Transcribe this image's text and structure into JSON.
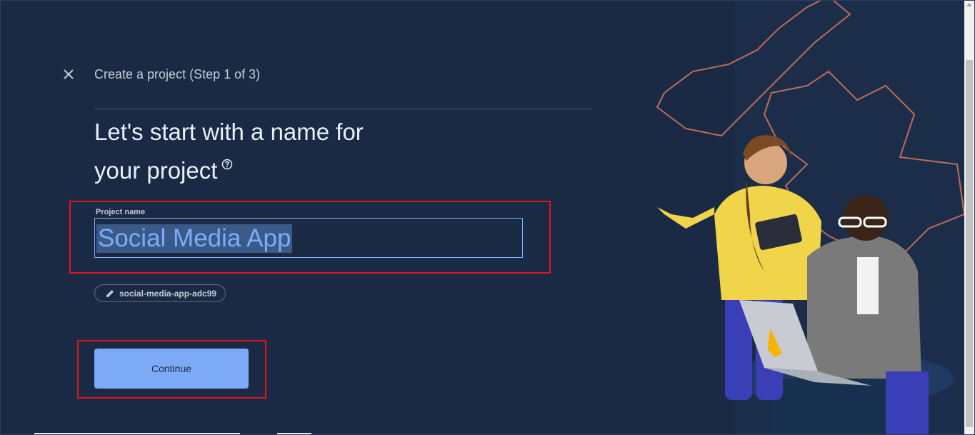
{
  "header": {
    "step_title": "Create a project (Step 1 of 3)"
  },
  "main": {
    "heading_line1": "Let's start with a name for",
    "heading_line2": "your project",
    "project_name_label": "Project name",
    "project_name_value": "Social Media App",
    "project_id_chip": "social-media-app-adc99",
    "continue_label": "Continue"
  },
  "icons": {
    "close": "close-icon",
    "help": "help-circle-icon",
    "edit": "pencil-icon"
  },
  "colors": {
    "background": "#1a2a44",
    "primary_button": "#7caaf7",
    "input_border": "#7fb0ff",
    "annotation": "#e0141c",
    "decor_outline": "#c06a5a"
  }
}
